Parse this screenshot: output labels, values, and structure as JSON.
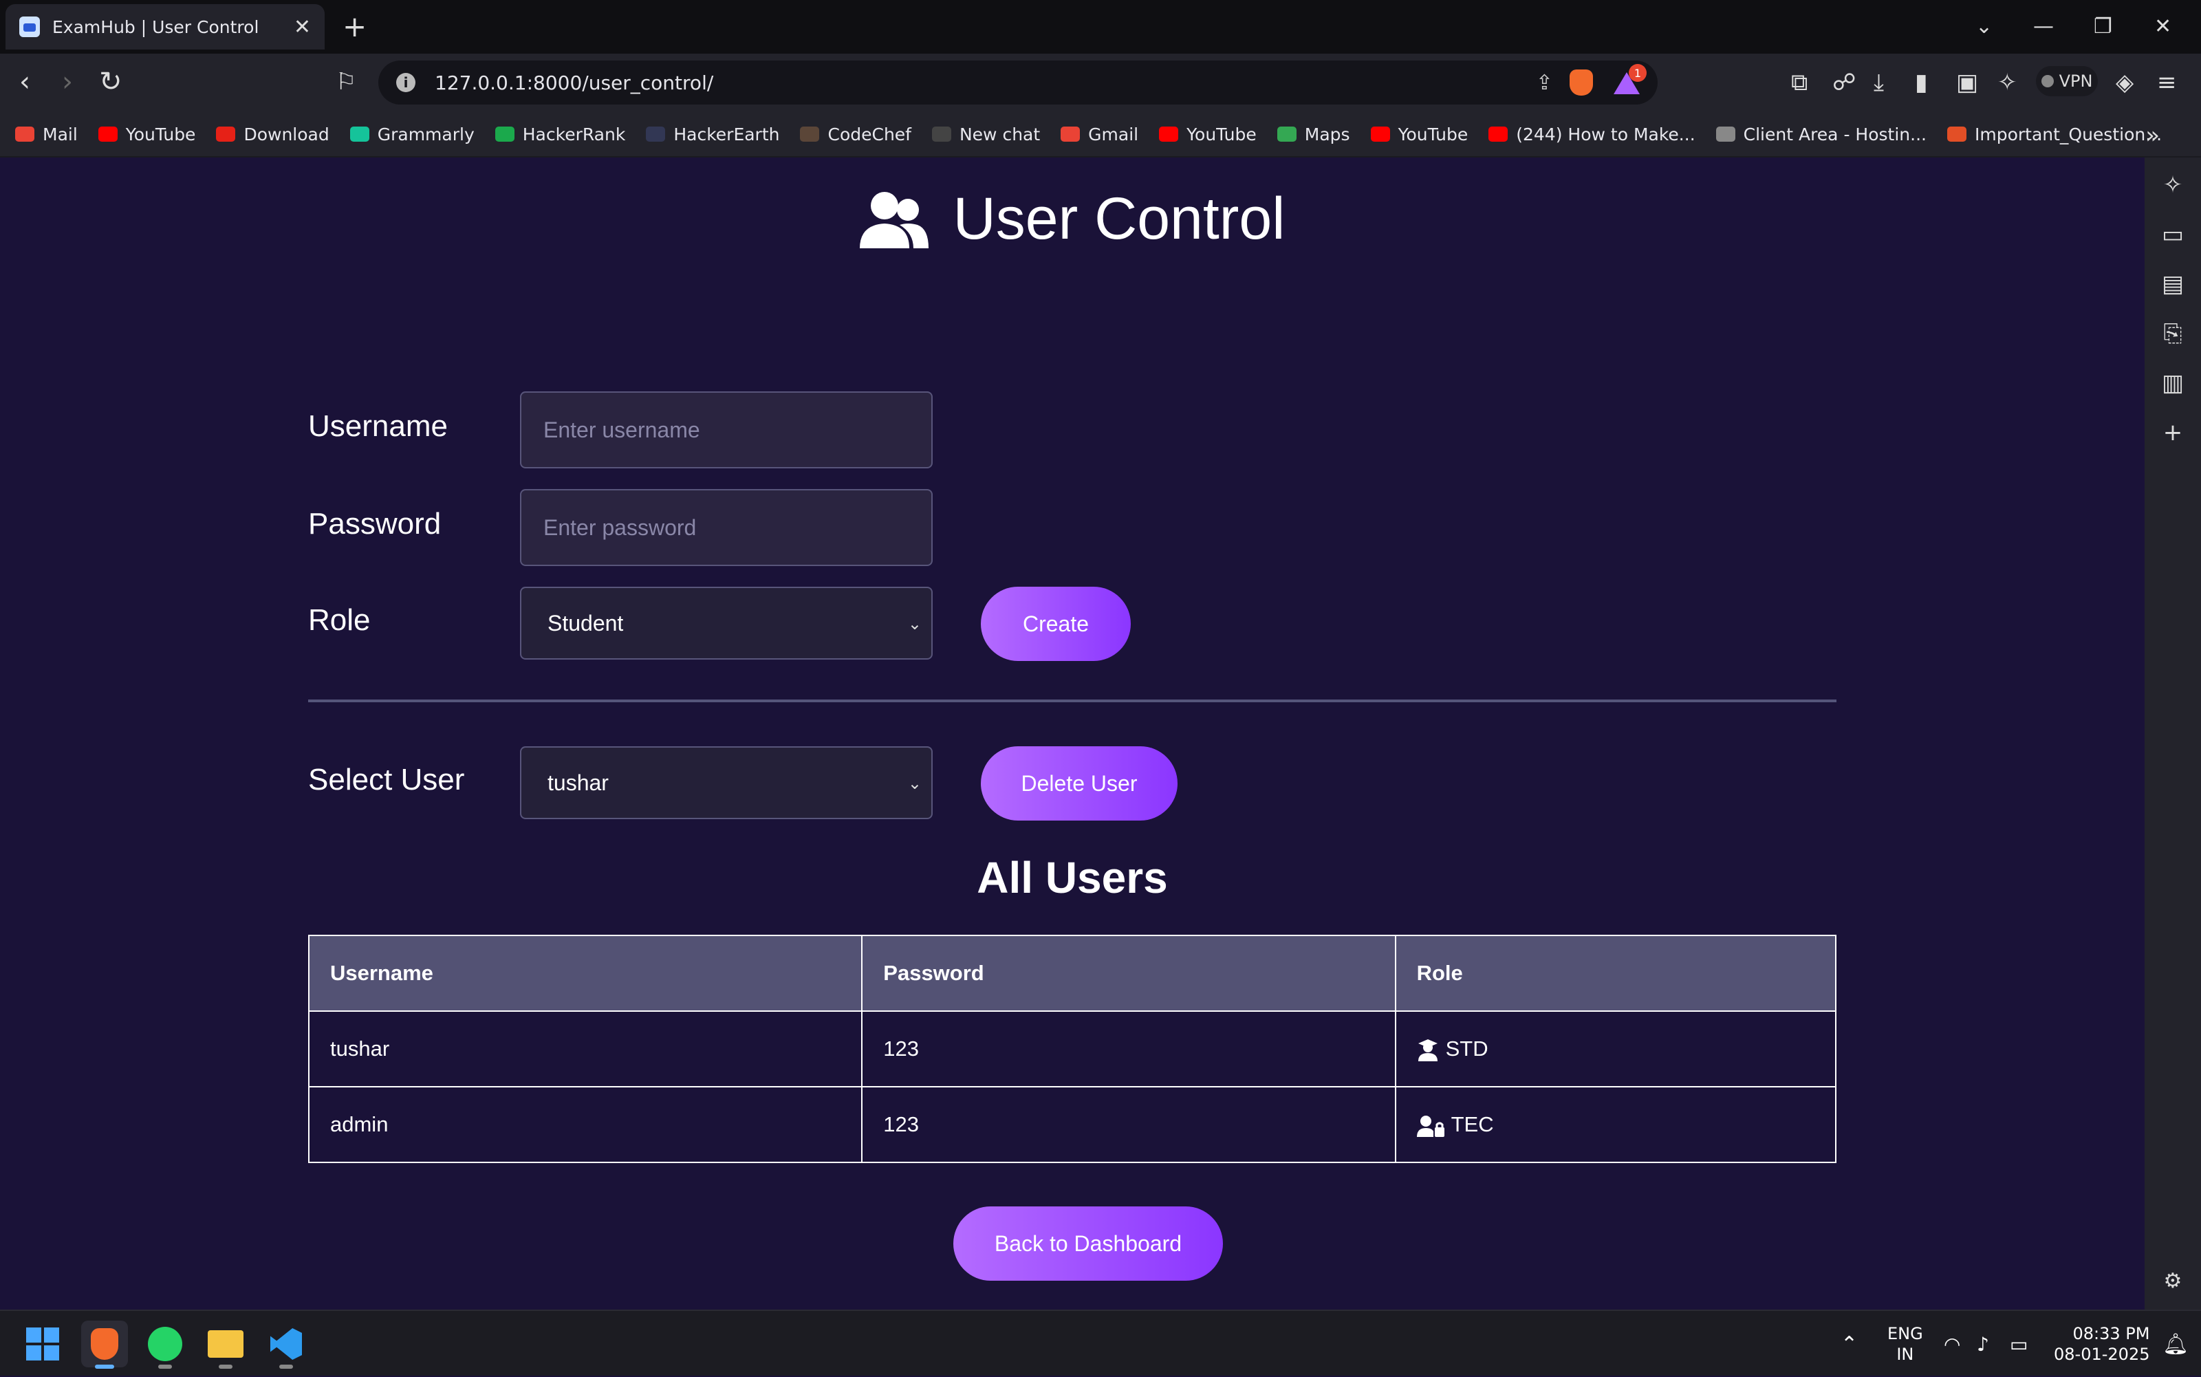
{
  "browser": {
    "tab_title": "ExamHub | User Control",
    "tab_close": "✕",
    "new_tab": "+",
    "url": "127.0.0.1:8000/user_control/",
    "rewards_badge": "1",
    "vpn_label": "VPN"
  },
  "bookmarks": [
    {
      "label": "Mail",
      "color": "#ea4335"
    },
    {
      "label": "YouTube",
      "color": "#ff0000"
    },
    {
      "label": "Download",
      "color": "#e62117"
    },
    {
      "label": "Grammarly",
      "color": "#15c39a"
    },
    {
      "label": "HackerRank",
      "color": "#1ba94c"
    },
    {
      "label": "HackerEarth",
      "color": "#323754"
    },
    {
      "label": "CodeChef",
      "color": "#5b4638"
    },
    {
      "label": "New chat",
      "color": "#444444"
    },
    {
      "label": "Gmail",
      "color": "#ea4335"
    },
    {
      "label": "YouTube",
      "color": "#ff0000"
    },
    {
      "label": "Maps",
      "color": "#34a853"
    },
    {
      "label": "YouTube",
      "color": "#ff0000"
    },
    {
      "label": "(244) How to Make...",
      "color": "#ff0000"
    },
    {
      "label": "Client Area - Hostin...",
      "color": "#888888"
    },
    {
      "label": "Important_Question...",
      "color": "#e34f26"
    }
  ],
  "page": {
    "title": "User Control",
    "title_icon": "users-icon"
  },
  "form": {
    "username_label": "Username",
    "username_placeholder": "Enter username",
    "password_label": "Password",
    "password_placeholder": "Enter password",
    "role_label": "Role",
    "role_selected": "Student",
    "create_button": "Create"
  },
  "delete": {
    "select_label": "Select User",
    "selected_user": "tushar",
    "delete_button": "Delete User"
  },
  "users_table": {
    "title": "All Users",
    "headers": [
      "Username",
      "Password",
      "Role"
    ],
    "rows": [
      {
        "username": "tushar",
        "password": "123",
        "role": "STD",
        "role_icon": "student-icon"
      },
      {
        "username": "admin",
        "password": "123",
        "role": "TEC",
        "role_icon": "teacher-icon"
      }
    ]
  },
  "back_button": "Back to Dashboard",
  "taskbar": {
    "lang_top": "ENG",
    "lang_bottom": "IN",
    "time": "08:33 PM",
    "date": "08-01-2025"
  },
  "colors": {
    "background": "#1a1238",
    "accent_start": "#b46bff",
    "accent_end": "#8b36ff",
    "table_header": "#535274"
  }
}
